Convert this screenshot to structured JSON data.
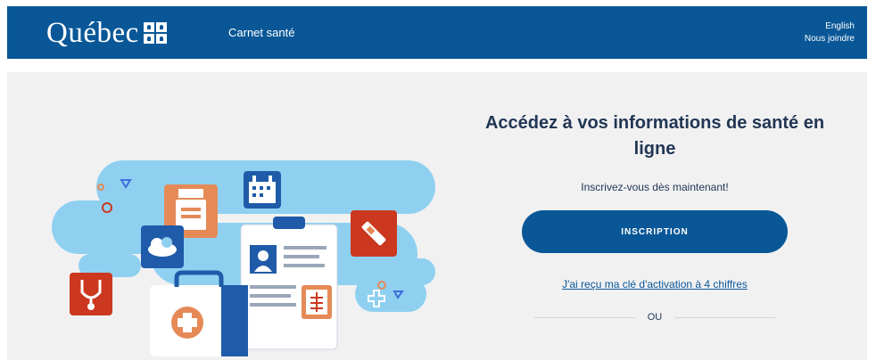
{
  "header": {
    "brand": "Québec",
    "product": "Carnet santé",
    "links": {
      "language": "English",
      "contact": "Nous joindre"
    }
  },
  "main": {
    "title": "Accédez à vos informations de santé en ligne",
    "subtitle": "Inscrivez-vous dès maintenant!",
    "cta_label": "INSCRIPTION",
    "activation_link": "J'ai reçu ma clé d'activation à 4 chiffres",
    "or_label": "OU"
  },
  "colors": {
    "primary": "#095797",
    "background": "#f1f1f2",
    "title_text": "#223654",
    "illustration_light_blue": "#8fd0f1",
    "illustration_orange": "#e58a57",
    "illustration_red": "#cb381f"
  },
  "icons": [
    "quebec-fleurdelise-icon",
    "calendar-icon",
    "clipboard-icon",
    "cloud-icon",
    "pill-bottle-icon",
    "syringe-icon",
    "stethoscope-icon",
    "first-aid-kit-icon",
    "xray-icon"
  ]
}
